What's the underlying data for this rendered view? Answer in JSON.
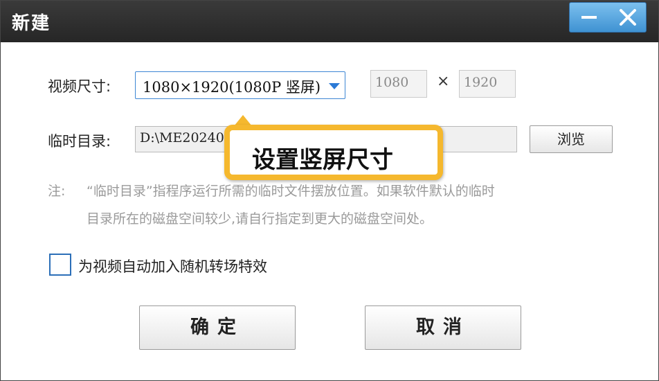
{
  "window": {
    "title": "新建"
  },
  "video_size": {
    "label": "视频尺寸:",
    "selected": "1080×1920(1080P 竖屏)",
    "width_value": "1080",
    "times": "×",
    "height_value": "1920"
  },
  "temp_dir": {
    "label": "临时目录:",
    "path": "D:\\ME202406",
    "browse_label": "浏览"
  },
  "note": {
    "prefix": "注:",
    "line1": "“临时目录”指程序运行所需的临时文件摆放位置。如果软件默认的临时",
    "line2": "目录所在的磁盘空间较少,请自行指定到更大的磁盘空间处。"
  },
  "transition": {
    "label": "为视频自动加入随机转场特效",
    "checked": false
  },
  "buttons": {
    "ok": "确定",
    "cancel": "取消"
  },
  "callout": {
    "text": "设置竖屏尺寸",
    "border_color": "#f5b82e"
  },
  "icons": {
    "minimize": "minimize-icon",
    "close": "close-icon",
    "dropdown": "chevron-down-icon"
  }
}
